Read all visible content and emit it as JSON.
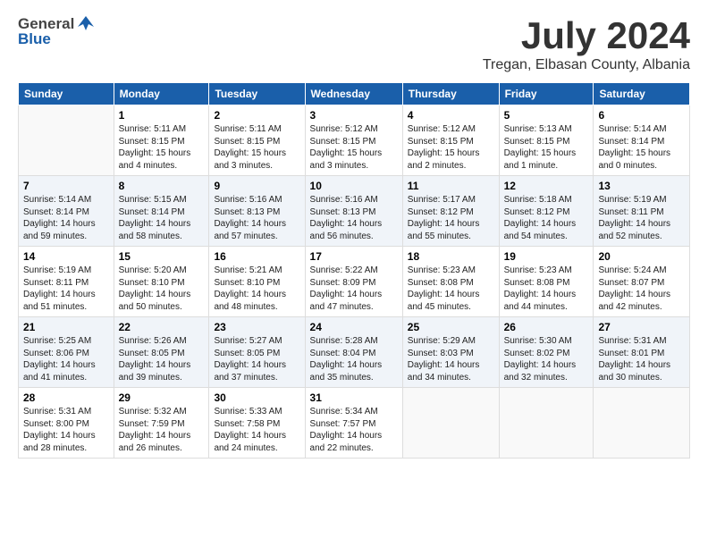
{
  "logo": {
    "general": "General",
    "blue": "Blue"
  },
  "title": "July 2024",
  "subtitle": "Tregan, Elbasan County, Albania",
  "days": [
    "Sunday",
    "Monday",
    "Tuesday",
    "Wednesday",
    "Thursday",
    "Friday",
    "Saturday"
  ],
  "weeks": [
    [
      {
        "num": "",
        "lines": []
      },
      {
        "num": "1",
        "lines": [
          "Sunrise: 5:11 AM",
          "Sunset: 8:15 PM",
          "Daylight: 15 hours",
          "and 4 minutes."
        ]
      },
      {
        "num": "2",
        "lines": [
          "Sunrise: 5:11 AM",
          "Sunset: 8:15 PM",
          "Daylight: 15 hours",
          "and 3 minutes."
        ]
      },
      {
        "num": "3",
        "lines": [
          "Sunrise: 5:12 AM",
          "Sunset: 8:15 PM",
          "Daylight: 15 hours",
          "and 3 minutes."
        ]
      },
      {
        "num": "4",
        "lines": [
          "Sunrise: 5:12 AM",
          "Sunset: 8:15 PM",
          "Daylight: 15 hours",
          "and 2 minutes."
        ]
      },
      {
        "num": "5",
        "lines": [
          "Sunrise: 5:13 AM",
          "Sunset: 8:15 PM",
          "Daylight: 15 hours",
          "and 1 minute."
        ]
      },
      {
        "num": "6",
        "lines": [
          "Sunrise: 5:14 AM",
          "Sunset: 8:14 PM",
          "Daylight: 15 hours",
          "and 0 minutes."
        ]
      }
    ],
    [
      {
        "num": "7",
        "lines": [
          "Sunrise: 5:14 AM",
          "Sunset: 8:14 PM",
          "Daylight: 14 hours",
          "and 59 minutes."
        ]
      },
      {
        "num": "8",
        "lines": [
          "Sunrise: 5:15 AM",
          "Sunset: 8:14 PM",
          "Daylight: 14 hours",
          "and 58 minutes."
        ]
      },
      {
        "num": "9",
        "lines": [
          "Sunrise: 5:16 AM",
          "Sunset: 8:13 PM",
          "Daylight: 14 hours",
          "and 57 minutes."
        ]
      },
      {
        "num": "10",
        "lines": [
          "Sunrise: 5:16 AM",
          "Sunset: 8:13 PM",
          "Daylight: 14 hours",
          "and 56 minutes."
        ]
      },
      {
        "num": "11",
        "lines": [
          "Sunrise: 5:17 AM",
          "Sunset: 8:12 PM",
          "Daylight: 14 hours",
          "and 55 minutes."
        ]
      },
      {
        "num": "12",
        "lines": [
          "Sunrise: 5:18 AM",
          "Sunset: 8:12 PM",
          "Daylight: 14 hours",
          "and 54 minutes."
        ]
      },
      {
        "num": "13",
        "lines": [
          "Sunrise: 5:19 AM",
          "Sunset: 8:11 PM",
          "Daylight: 14 hours",
          "and 52 minutes."
        ]
      }
    ],
    [
      {
        "num": "14",
        "lines": [
          "Sunrise: 5:19 AM",
          "Sunset: 8:11 PM",
          "Daylight: 14 hours",
          "and 51 minutes."
        ]
      },
      {
        "num": "15",
        "lines": [
          "Sunrise: 5:20 AM",
          "Sunset: 8:10 PM",
          "Daylight: 14 hours",
          "and 50 minutes."
        ]
      },
      {
        "num": "16",
        "lines": [
          "Sunrise: 5:21 AM",
          "Sunset: 8:10 PM",
          "Daylight: 14 hours",
          "and 48 minutes."
        ]
      },
      {
        "num": "17",
        "lines": [
          "Sunrise: 5:22 AM",
          "Sunset: 8:09 PM",
          "Daylight: 14 hours",
          "and 47 minutes."
        ]
      },
      {
        "num": "18",
        "lines": [
          "Sunrise: 5:23 AM",
          "Sunset: 8:08 PM",
          "Daylight: 14 hours",
          "and 45 minutes."
        ]
      },
      {
        "num": "19",
        "lines": [
          "Sunrise: 5:23 AM",
          "Sunset: 8:08 PM",
          "Daylight: 14 hours",
          "and 44 minutes."
        ]
      },
      {
        "num": "20",
        "lines": [
          "Sunrise: 5:24 AM",
          "Sunset: 8:07 PM",
          "Daylight: 14 hours",
          "and 42 minutes."
        ]
      }
    ],
    [
      {
        "num": "21",
        "lines": [
          "Sunrise: 5:25 AM",
          "Sunset: 8:06 PM",
          "Daylight: 14 hours",
          "and 41 minutes."
        ]
      },
      {
        "num": "22",
        "lines": [
          "Sunrise: 5:26 AM",
          "Sunset: 8:05 PM",
          "Daylight: 14 hours",
          "and 39 minutes."
        ]
      },
      {
        "num": "23",
        "lines": [
          "Sunrise: 5:27 AM",
          "Sunset: 8:05 PM",
          "Daylight: 14 hours",
          "and 37 minutes."
        ]
      },
      {
        "num": "24",
        "lines": [
          "Sunrise: 5:28 AM",
          "Sunset: 8:04 PM",
          "Daylight: 14 hours",
          "and 35 minutes."
        ]
      },
      {
        "num": "25",
        "lines": [
          "Sunrise: 5:29 AM",
          "Sunset: 8:03 PM",
          "Daylight: 14 hours",
          "and 34 minutes."
        ]
      },
      {
        "num": "26",
        "lines": [
          "Sunrise: 5:30 AM",
          "Sunset: 8:02 PM",
          "Daylight: 14 hours",
          "and 32 minutes."
        ]
      },
      {
        "num": "27",
        "lines": [
          "Sunrise: 5:31 AM",
          "Sunset: 8:01 PM",
          "Daylight: 14 hours",
          "and 30 minutes."
        ]
      }
    ],
    [
      {
        "num": "28",
        "lines": [
          "Sunrise: 5:31 AM",
          "Sunset: 8:00 PM",
          "Daylight: 14 hours",
          "and 28 minutes."
        ]
      },
      {
        "num": "29",
        "lines": [
          "Sunrise: 5:32 AM",
          "Sunset: 7:59 PM",
          "Daylight: 14 hours",
          "and 26 minutes."
        ]
      },
      {
        "num": "30",
        "lines": [
          "Sunrise: 5:33 AM",
          "Sunset: 7:58 PM",
          "Daylight: 14 hours",
          "and 24 minutes."
        ]
      },
      {
        "num": "31",
        "lines": [
          "Sunrise: 5:34 AM",
          "Sunset: 7:57 PM",
          "Daylight: 14 hours",
          "and 22 minutes."
        ]
      },
      {
        "num": "",
        "lines": []
      },
      {
        "num": "",
        "lines": []
      },
      {
        "num": "",
        "lines": []
      }
    ]
  ]
}
